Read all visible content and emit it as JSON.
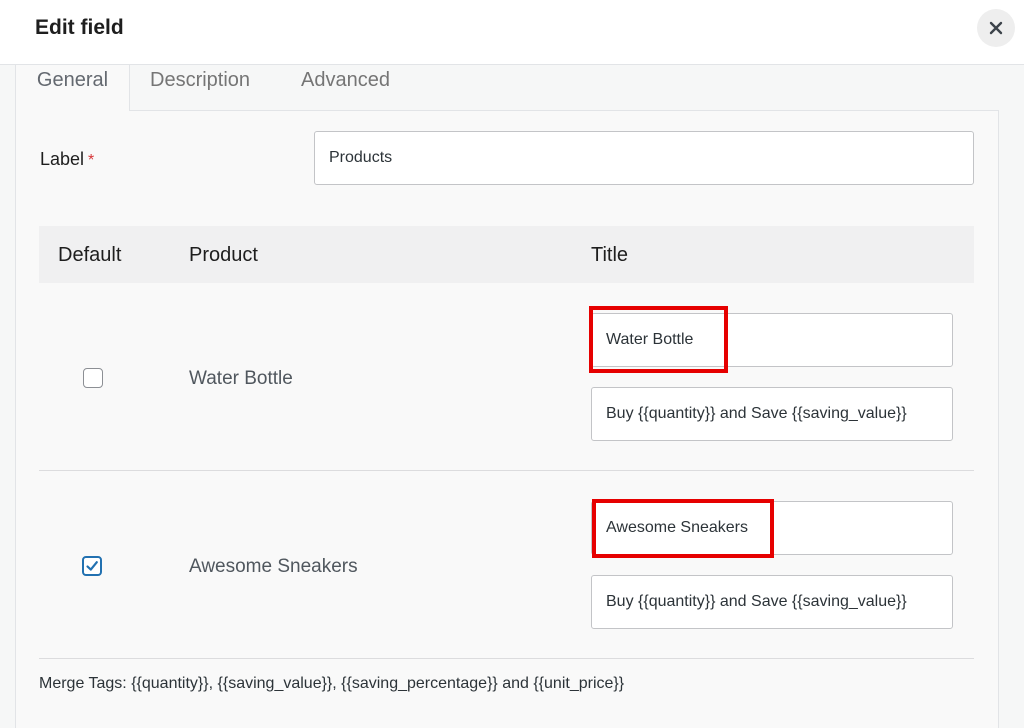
{
  "dialog": {
    "title": "Edit field",
    "close_icon": "close-icon"
  },
  "tabs": [
    {
      "label": "General",
      "active": true
    },
    {
      "label": "Description",
      "active": false
    },
    {
      "label": "Advanced",
      "active": false
    }
  ],
  "label_field": {
    "label": "Label",
    "required_mark": "*",
    "value": "Products"
  },
  "table": {
    "headers": {
      "default": "Default",
      "product": "Product",
      "title": "Title"
    },
    "rows": [
      {
        "default_checked": false,
        "product": "Water Bottle",
        "title": "Water Bottle",
        "subtitle": "Buy {{quantity}} and Save {{saving_value}}"
      },
      {
        "default_checked": true,
        "product": "Awesome Sneakers",
        "title": "Awesome Sneakers",
        "subtitle": "Buy {{quantity}} and Save {{saving_value}}"
      }
    ]
  },
  "merge_tags": "Merge Tags: {{quantity}}, {{saving_value}}, {{saving_percentage}} and {{unit_price}}",
  "colors": {
    "highlight": "#e60000",
    "accent": "#2271b1",
    "required": "#d63638"
  }
}
